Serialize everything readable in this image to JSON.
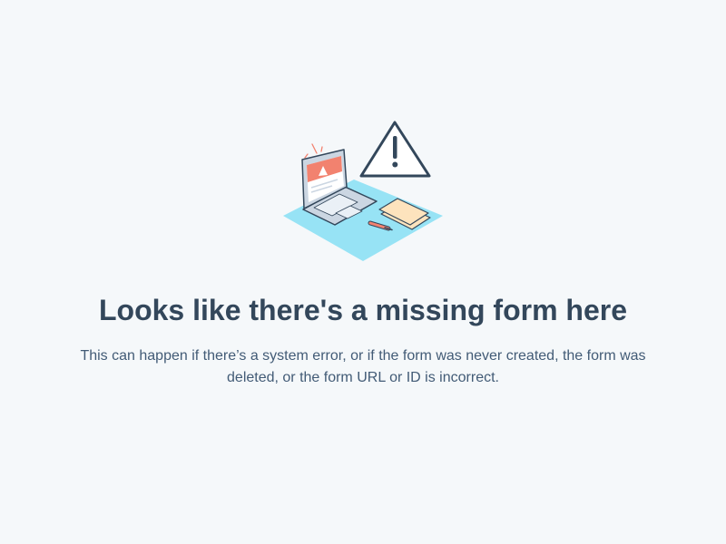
{
  "error_page": {
    "illustration_icon": "laptop-warning-illustration",
    "title": "Looks like there's a missing form here",
    "message": "This can happen if there’s a system error, or if the form was never created, the form was deleted, or the form URL or ID is incorrect."
  },
  "colors": {
    "background": "#f5f8fa",
    "title": "#33475b",
    "body_text": "#425b76",
    "accent_blue": "#97e3f5",
    "alert_red": "#f2826f"
  }
}
